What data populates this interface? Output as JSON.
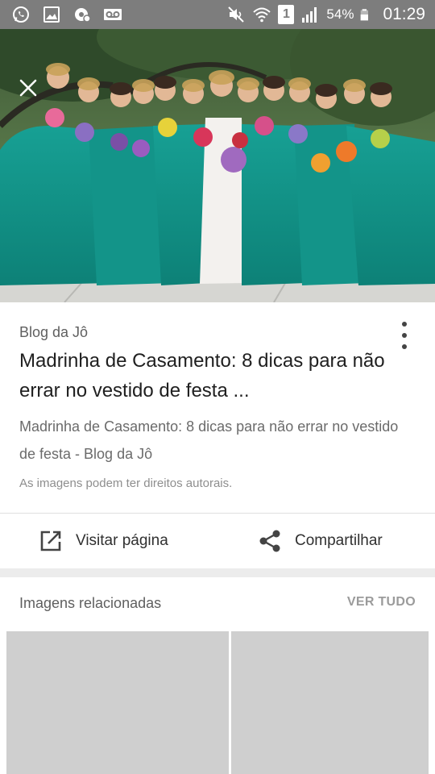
{
  "status_bar": {
    "left_icons": [
      "whatsapp-icon",
      "gallery-icon",
      "settings-notification-icon",
      "voicemail-icon"
    ],
    "right_icons": [
      "mute-icon",
      "wifi-icon",
      "sim-icon",
      "signal-icon",
      "battery-icon"
    ],
    "sim_number": "1",
    "battery": "54%",
    "time": "01:29"
  },
  "viewer": {
    "close_icon": "close-icon"
  },
  "result": {
    "source": "Blog da Jô",
    "title": "Madrinha de Casamento: 8 dicas para não errar no vestido de festa ...",
    "description": "Madrinha de Casamento: 8 dicas para não errar no vestido de festa - Blog da Jô",
    "copyright_notice": "As imagens podem ter direitos autorais.",
    "menu_icon": "more-vert-icon"
  },
  "actions": {
    "visit_label": "Visitar página",
    "visit_icon": "open-in-new-icon",
    "share_label": "Compartilhar",
    "share_icon": "share-icon"
  },
  "related": {
    "title": "Imagens relacionadas",
    "see_all": "VER TUDO"
  },
  "colors": {
    "status_bar": "#7d7d7d",
    "dress_teal": "#1a9e92",
    "placeholder": "#cfcfcf"
  }
}
